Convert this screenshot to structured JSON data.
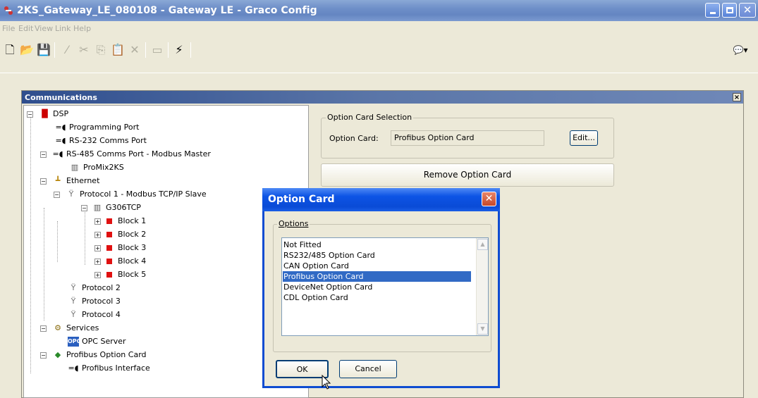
{
  "window": {
    "title": "2KS_Gateway_LE_080108 - Gateway LE - Graco Config"
  },
  "menu": [
    "File",
    "Edit",
    "View",
    "Link",
    "Help"
  ],
  "toolbar": {
    "new": "🗋",
    "open": "📂",
    "save": "💾",
    "edit": "⁄",
    "cut": "✂",
    "copy": "⎘",
    "paste": "📋",
    "delete": "✕",
    "rename": "▭",
    "flash": "⚡",
    "help": "💬▾"
  },
  "panel": {
    "title": "Communications",
    "close": "×"
  },
  "tree": [
    {
      "label": "DSP"
    },
    {
      "label": "Programming Port"
    },
    {
      "label": "RS-232 Comms Port"
    },
    {
      "label": "RS-485 Comms Port - Modbus Master"
    },
    {
      "label": "ProMix2KS"
    },
    {
      "label": "Ethernet"
    },
    {
      "label": "Protocol 1 - Modbus TCP/IP Slave"
    },
    {
      "label": "G306TCP"
    },
    {
      "label": "Block 1"
    },
    {
      "label": "Block 2"
    },
    {
      "label": "Block 3"
    },
    {
      "label": "Block 4"
    },
    {
      "label": "Block 5"
    },
    {
      "label": "Protocol 2"
    },
    {
      "label": "Protocol 3"
    },
    {
      "label": "Protocol 4"
    },
    {
      "label": "Services"
    },
    {
      "label": "OPC Server"
    },
    {
      "label": "Profibus Option Card"
    },
    {
      "label": "Profibus Interface"
    }
  ],
  "option_card_group": {
    "legend": "Option Card Selection",
    "label": "Option Card:",
    "value": "Profibus Option Card",
    "edit_button": "Edit...",
    "remove_button": "Remove Option Card"
  },
  "dialog": {
    "title": "Option Card",
    "close": "✕",
    "options_legend": "Options",
    "options": [
      "Not Fitted",
      "RS232/485 Option Card",
      "CAN Option Card",
      "Profibus Option Card",
      "DeviceNet Option Card",
      "CDL Option Card"
    ],
    "selected_index": 3,
    "ok": "OK",
    "cancel": "Cancel"
  }
}
